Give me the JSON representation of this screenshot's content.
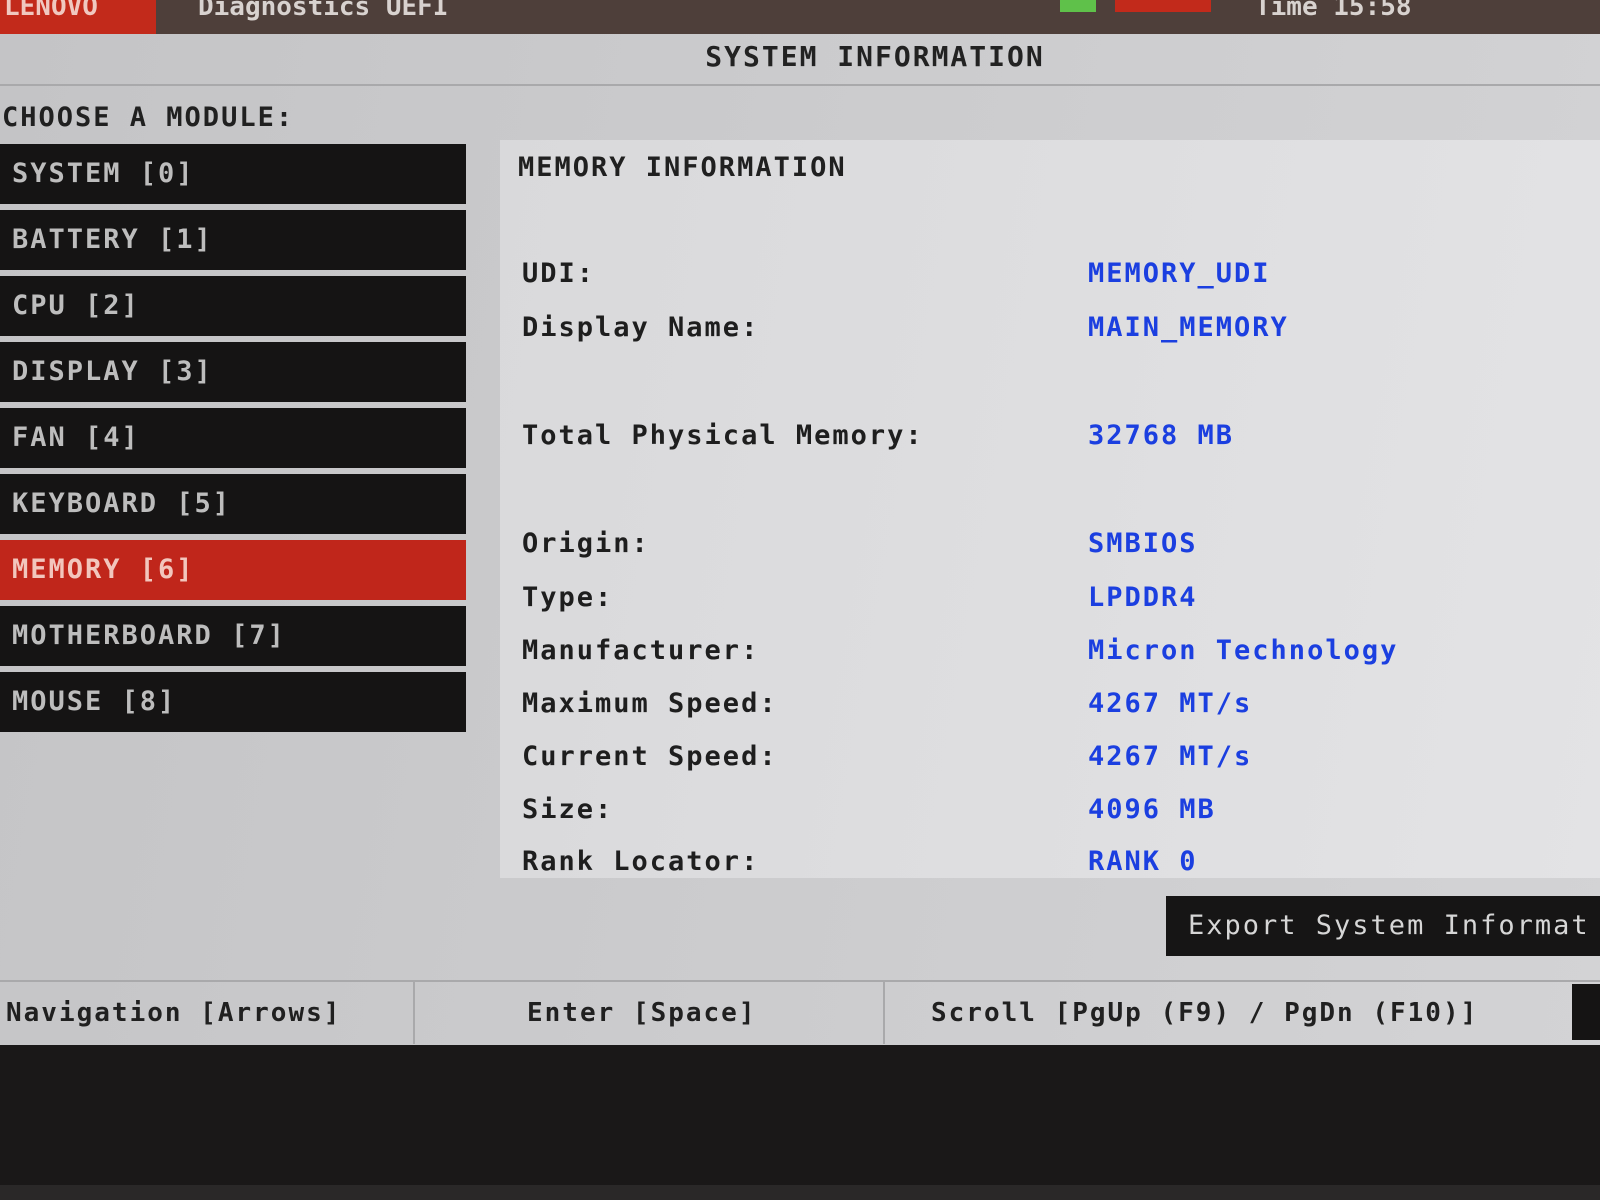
{
  "header": {
    "brand": "LENOVO",
    "app_title": "Diagnostics UEFI",
    "time_text": "Time 15:58"
  },
  "title": "SYSTEM INFORMATION",
  "module_chooser": {
    "label": "CHOOSE A MODULE:",
    "items": [
      {
        "label": "SYSTEM [0]"
      },
      {
        "label": "BATTERY [1]"
      },
      {
        "label": "CPU [2]"
      },
      {
        "label": "DISPLAY [3]"
      },
      {
        "label": "FAN [4]"
      },
      {
        "label": "KEYBOARD [5]"
      },
      {
        "label": "MEMORY [6]"
      },
      {
        "label": "MOTHERBOARD [7]"
      },
      {
        "label": "MOUSE [8]"
      }
    ],
    "selected": "MEMORY [6]"
  },
  "memory_info": {
    "heading": "MEMORY INFORMATION",
    "rows": [
      {
        "label": "UDI:",
        "value": "MEMORY_UDI"
      },
      {
        "label": "Display Name:",
        "value": "MAIN_MEMORY"
      },
      {
        "label": "Total Physical Memory:",
        "value": "32768 MB"
      },
      {
        "label": "Origin:",
        "value": "SMBIOS"
      },
      {
        "label": "Type:",
        "value": "LPDDR4"
      },
      {
        "label": "Manufacturer:",
        "value": "Micron Technology"
      },
      {
        "label": "Maximum Speed:",
        "value": "4267 MT/s"
      },
      {
        "label": "Current Speed:",
        "value": "4267 MT/s"
      },
      {
        "label": "Size:",
        "value": "4096 MB"
      },
      {
        "label": "Rank Locator:",
        "value": "RANK 0"
      }
    ]
  },
  "actions": {
    "export_label": "Export System Informat"
  },
  "footer": {
    "hints": [
      "Navigation [Arrows]",
      "Enter [Space]",
      "Scroll [PgUp (F9) / PgDn (F10)]"
    ]
  },
  "colors": {
    "accent_red": "#c0261b",
    "value_blue": "#1b3fe0",
    "module_bg": "#151414"
  }
}
